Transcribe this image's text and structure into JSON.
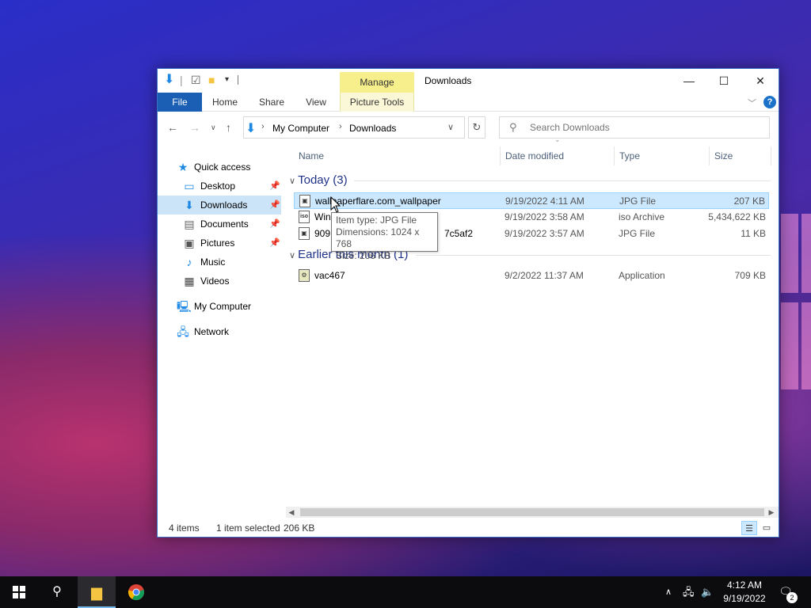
{
  "window": {
    "title": "Downloads",
    "manage_tab": "Manage",
    "buttons": {
      "minimize": "—",
      "maximize": "☐",
      "close": "✕"
    }
  },
  "ribbon": {
    "tabs": [
      "File",
      "Home",
      "Share",
      "View",
      "Picture Tools"
    ]
  },
  "address": {
    "parts": [
      "My Computer",
      "Downloads"
    ]
  },
  "search": {
    "placeholder": "Search Downloads"
  },
  "nav_pane": {
    "items": [
      {
        "label": "Quick access",
        "icon": "star-icon"
      },
      {
        "label": "Desktop",
        "icon": "desktop-icon",
        "pinned": true
      },
      {
        "label": "Downloads",
        "icon": "download-icon",
        "pinned": true,
        "active": true
      },
      {
        "label": "Documents",
        "icon": "documents-icon",
        "pinned": true
      },
      {
        "label": "Pictures",
        "icon": "pictures-icon",
        "pinned": true
      },
      {
        "label": "Music",
        "icon": "music-icon"
      },
      {
        "label": "Videos",
        "icon": "videos-icon"
      },
      {
        "label": "My Computer",
        "icon": "computer-icon"
      },
      {
        "label": "Network",
        "icon": "network-icon"
      }
    ]
  },
  "columns": {
    "name": "Name",
    "date": "Date modified",
    "type": "Type",
    "size": "Size"
  },
  "groups": [
    {
      "label": "Today (3)",
      "files": [
        {
          "name": "wallpaperflare.com_wallpaper",
          "date": "9/19/2022 4:11 AM",
          "type": "JPG File",
          "size": "207 KB",
          "selected": true
        },
        {
          "name": "Win",
          "date": "9/19/2022 3:58 AM",
          "type": "iso Archive",
          "size": "5,434,622 KB"
        },
        {
          "name": "909",
          "name_tail": "7c5af2",
          "date": "9/19/2022 3:57 AM",
          "type": "JPG File",
          "size": "11 KB"
        }
      ]
    },
    {
      "label": "Earlier this month (1)",
      "files": [
        {
          "name": "vac467",
          "date": "9/2/2022 11:37 AM",
          "type": "Application",
          "size": "709 KB"
        }
      ]
    }
  ],
  "tooltip": {
    "type": "Item type: JPG File",
    "dimensions": "Dimensions: 1024 x 768",
    "size": "Size: 206 KB"
  },
  "status": {
    "items": "4 items",
    "selected": "1 item selected",
    "size": "206 KB"
  },
  "taskbar": {
    "time": "4:12 AM",
    "date": "9/19/2022",
    "notifications": "2"
  },
  "colors": {
    "accent": "#1a5fb4",
    "selection": "#cce8ff",
    "group_header": "#1e3287"
  }
}
